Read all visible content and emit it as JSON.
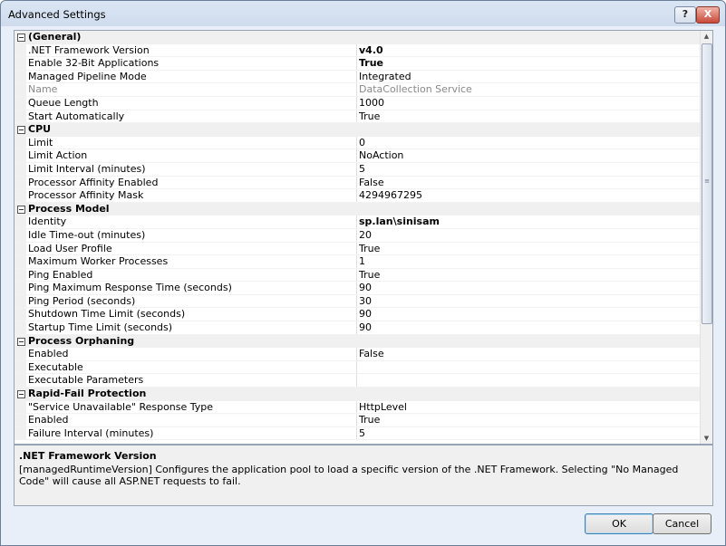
{
  "window": {
    "title": "Advanced Settings",
    "help_label": "?",
    "close_label": "X"
  },
  "grid": {
    "categories": [
      {
        "name": "(General)",
        "props": [
          {
            "name": ".NET Framework Version",
            "value": "v4.0",
            "bold": true
          },
          {
            "name": "Enable 32-Bit Applications",
            "value": "True",
            "bold": true
          },
          {
            "name": "Managed Pipeline Mode",
            "value": "Integrated"
          },
          {
            "name": "Name",
            "value": "DataCollection Service",
            "muted": true
          },
          {
            "name": "Queue Length",
            "value": "1000"
          },
          {
            "name": "Start Automatically",
            "value": "True"
          }
        ]
      },
      {
        "name": "CPU",
        "props": [
          {
            "name": "Limit",
            "value": "0"
          },
          {
            "name": "Limit Action",
            "value": "NoAction"
          },
          {
            "name": "Limit Interval (minutes)",
            "value": "5"
          },
          {
            "name": "Processor Affinity Enabled",
            "value": "False"
          },
          {
            "name": "Processor Affinity Mask",
            "value": "4294967295"
          }
        ]
      },
      {
        "name": "Process Model",
        "props": [
          {
            "name": "Identity",
            "value": "sp.lan\\sinisam",
            "bold": true
          },
          {
            "name": "Idle Time-out (minutes)",
            "value": "20"
          },
          {
            "name": "Load User Profile",
            "value": "True"
          },
          {
            "name": "Maximum Worker Processes",
            "value": "1"
          },
          {
            "name": "Ping Enabled",
            "value": "True"
          },
          {
            "name": "Ping Maximum Response Time (seconds)",
            "value": "90"
          },
          {
            "name": "Ping Period (seconds)",
            "value": "30"
          },
          {
            "name": "Shutdown Time Limit (seconds)",
            "value": "90"
          },
          {
            "name": "Startup Time Limit (seconds)",
            "value": "90"
          }
        ]
      },
      {
        "name": "Process Orphaning",
        "props": [
          {
            "name": "Enabled",
            "value": "False"
          },
          {
            "name": "Executable",
            "value": ""
          },
          {
            "name": "Executable Parameters",
            "value": ""
          }
        ]
      },
      {
        "name": "Rapid-Fail Protection",
        "props": [
          {
            "name": "\"Service Unavailable\" Response Type",
            "value": "HttpLevel"
          },
          {
            "name": "Enabled",
            "value": "True"
          },
          {
            "name": "Failure Interval (minutes)",
            "value": "5"
          }
        ]
      }
    ]
  },
  "description": {
    "title": ".NET Framework Version",
    "text": "[managedRuntimeVersion] Configures the application pool to load a specific version of the .NET Framework.  Selecting \"No Managed Code\" will cause all ASP.NET requests to fail."
  },
  "buttons": {
    "ok": "OK",
    "cancel": "Cancel"
  }
}
